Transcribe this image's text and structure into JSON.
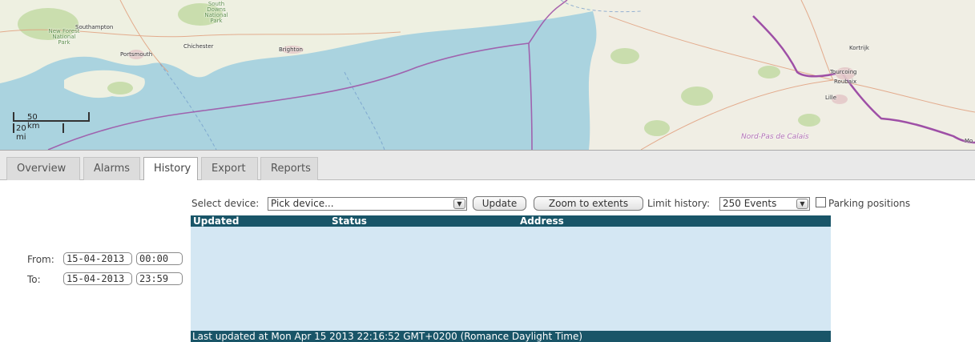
{
  "map": {
    "places": [
      "Southampton",
      "Portsmouth",
      "Chichester",
      "Brighton",
      "Kortrijk",
      "Tourcoing",
      "Roubaix",
      "Lille",
      "Mo"
    ],
    "parks": [
      "New Forest National Park",
      "South Downs National Park"
    ],
    "region": "Nord-Pas de Calais",
    "scale": {
      "km": "50 km",
      "mi": "20 mi"
    },
    "colors": {
      "sea": "#aad3df",
      "land": "#f2efe9",
      "border": "#9e4fa6",
      "road": "#e09b78"
    }
  },
  "tabs": [
    {
      "label": "Overview",
      "active": false
    },
    {
      "label": "Alarms",
      "active": false
    },
    {
      "label": "History",
      "active": true
    },
    {
      "label": "Export",
      "active": false
    },
    {
      "label": "Reports",
      "active": false
    }
  ],
  "filters": {
    "from_label": "From:",
    "from_date": "15-04-2013",
    "from_time": "00:00",
    "to_label": "To:",
    "to_date": "15-04-2013",
    "to_time": "23:59"
  },
  "toolbar": {
    "select_device_label": "Select device:",
    "device_value": "Pick device...",
    "update_button": "Update",
    "zoom_button": "Zoom to extents",
    "limit_label": "Limit history:",
    "limit_value": "250 Events",
    "parking_label": "Parking positions",
    "parking_checked": false
  },
  "grid": {
    "columns": [
      "Updated",
      "Status",
      "Address"
    ],
    "rows": [],
    "footer": "Last updated at Mon Apr 15 2013 22:16:52 GMT+0200 (Romance Daylight Time)",
    "colors": {
      "header": "#195568",
      "body": "#d4e7f3"
    }
  }
}
